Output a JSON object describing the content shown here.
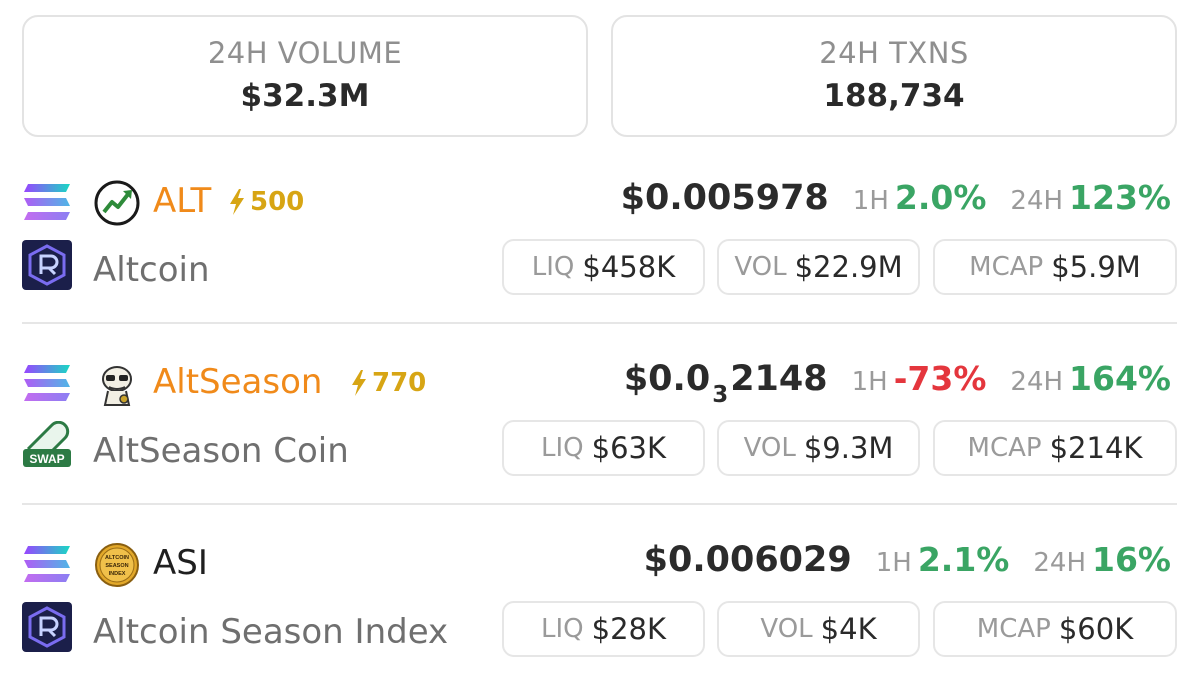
{
  "stats": {
    "volume": {
      "label": "24H VOLUME",
      "value": "$32.3M"
    },
    "txns": {
      "label": "24H TXNS",
      "value": "188,734"
    }
  },
  "tokens": [
    {
      "symbol": "ALT",
      "boost": "500",
      "name": "Altcoin",
      "price_main": "$0.005978",
      "price_sub": "",
      "price_rest": "",
      "h1_label": "1H",
      "h1": "2.0%",
      "h24_label": "24H",
      "h24": "123%",
      "liq_label": "LIQ",
      "liq": "$458K",
      "vol_label": "VOL",
      "vol": "$22.9M",
      "mcap_label": "MCAP",
      "mcap": "$5.9M",
      "chain_icon": "solana-icon",
      "token_icon": "trend-chart-icon",
      "dex_icon": "raydium-icon"
    },
    {
      "symbol": "AltSeason",
      "boost": "770",
      "name": "AltSeason Coin",
      "price_main": "$0.0",
      "price_sub": "3",
      "price_rest": "2148",
      "h1_label": "1H",
      "h1": "-73%",
      "h24_label": "24H",
      "h24": "164%",
      "liq_label": "LIQ",
      "liq": "$63K",
      "vol_label": "VOL",
      "vol": "$9.3M",
      "mcap_label": "MCAP",
      "mcap": "$214K",
      "chain_icon": "solana-icon",
      "token_icon": "pepe-cartoon-icon",
      "dex_icon": "pill-swap-icon"
    },
    {
      "symbol": "ASI",
      "boost": "",
      "name": "Altcoin Season Index",
      "price_main": "$0.006029",
      "price_sub": "",
      "price_rest": "",
      "h1_label": "1H",
      "h1": "2.1%",
      "h24_label": "24H",
      "h24": "16%",
      "liq_label": "LIQ",
      "liq": "$28K",
      "vol_label": "VOL",
      "vol": "$4K",
      "mcap_label": "MCAP",
      "mcap": "$60K",
      "chain_icon": "solana-icon",
      "token_icon": "gold-coin-icon",
      "token_icon_text": [
        "ALTCOIN",
        "SEASON",
        "INDEX"
      ],
      "dex_icon": "raydium-icon"
    }
  ],
  "colors": {
    "up": "#3aa564",
    "down": "#e4363d",
    "boost": "#d7a514",
    "symbol_highlight": "#f08a1a",
    "raydium_bg": "#1b1f4a"
  }
}
